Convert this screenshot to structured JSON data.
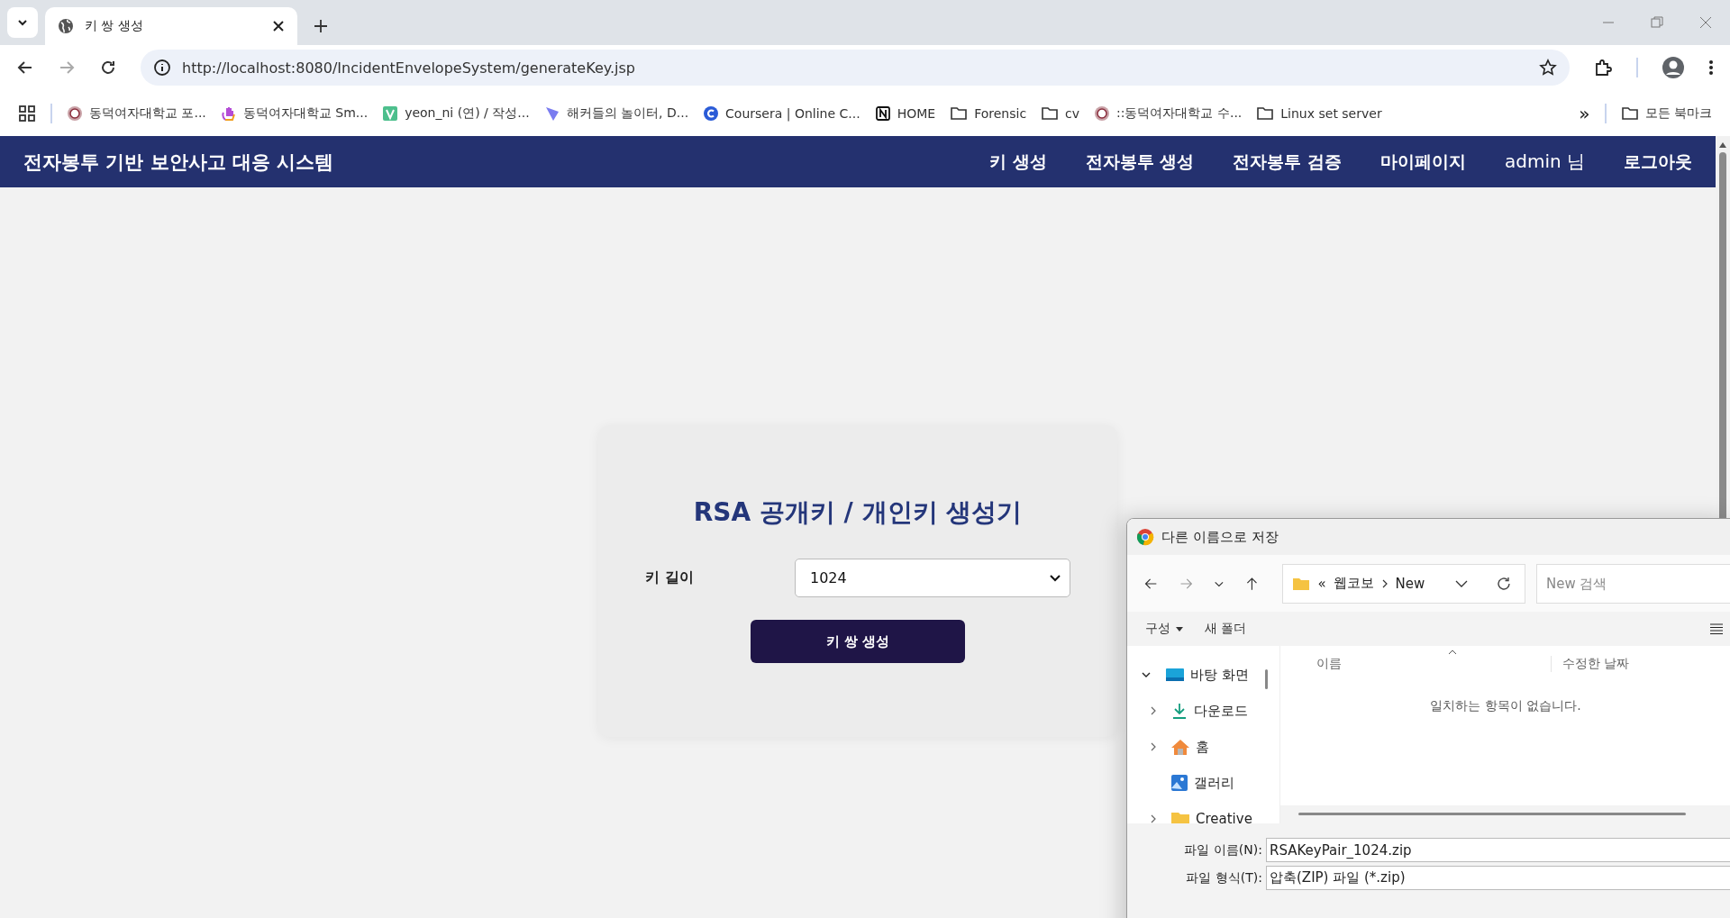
{
  "browser": {
    "tabs": [
      {
        "title": "키 쌍 생성",
        "selected": true
      }
    ],
    "url": "http://localhost:8080/IncidentEnvelopeSystem/generateKey.jsp",
    "bookmarks": [
      {
        "label": "동덕여자대학교 포...",
        "kind": "seal"
      },
      {
        "label": "동덕여자대학교 Sm...",
        "kind": "hand"
      },
      {
        "label": "yeon_ni (연) / 작성...",
        "kind": "badge"
      },
      {
        "label": "해커들의 놀이터, D...",
        "kind": "shield"
      },
      {
        "label": "Coursera | Online C...",
        "kind": "coursera"
      },
      {
        "label": "HOME",
        "kind": "notion"
      },
      {
        "label": "Forensic",
        "kind": "folder"
      },
      {
        "label": "cv",
        "kind": "folder"
      },
      {
        "label": "::동덕여자대학교 수...",
        "kind": "seal"
      },
      {
        "label": "Linux set server",
        "kind": "folder"
      }
    ],
    "overflow": "»",
    "all_bookmarks": "모든 북마크"
  },
  "navbar": {
    "brand": "전자봉투 기반 보안사고 대응 시스템",
    "links": [
      {
        "label": "키 생성",
        "kind": "link"
      },
      {
        "label": "전자봉투 생성",
        "kind": "link"
      },
      {
        "label": "전자봉투 검증",
        "kind": "link"
      },
      {
        "label": "마이페이지",
        "kind": "link"
      },
      {
        "label": "admin 님",
        "kind": "user"
      },
      {
        "label": "로그아웃",
        "kind": "link"
      }
    ]
  },
  "card": {
    "title": "RSA 공개키 / 개인키 생성기",
    "field_label": "키 길이",
    "select_value": "1024",
    "button": "키 쌍 생성"
  },
  "save_dialog": {
    "title": "다른 이름으로 저장",
    "path_prefix": "«",
    "path": [
      "웹코보",
      "New"
    ],
    "search_placeholder": "New 검색",
    "commands": [
      {
        "label": "구성",
        "kind": "menu"
      },
      {
        "label": "새 폴더",
        "kind": "plain"
      }
    ],
    "nav_items": [
      {
        "label": "바탕 화면",
        "kind": "desktop",
        "expanded": true,
        "children": [
          {
            "label": "다운로드",
            "kind": "download",
            "has_children": true,
            "expanded": false
          },
          {
            "label": "홈",
            "kind": "home",
            "has_children": true,
            "expanded": false
          },
          {
            "label": "갤러리",
            "kind": "gallery",
            "has_children": false,
            "expanded": false
          },
          {
            "label": "Creative",
            "kind": "folder",
            "has_children": true,
            "expanded": false
          }
        ]
      }
    ],
    "columns": [
      "이름",
      "수정한 날짜"
    ],
    "empty_message": "일치하는 항목이 없습니다.",
    "fields": [
      {
        "label": "파일 이름(N):",
        "value": "RSAKeyPair_1024.zip"
      },
      {
        "label": "파일 형식(T):",
        "value": "압축(ZIP) 파일 (*.zip)"
      }
    ]
  }
}
